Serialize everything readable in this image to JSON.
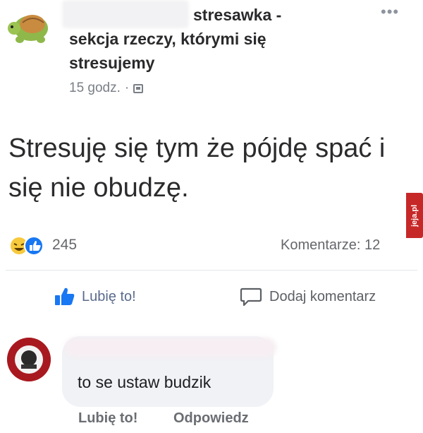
{
  "post": {
    "group_name": "stresawka - sekcja rzeczy, którymi się stresujemy",
    "time": "15 godz.",
    "separator": "·",
    "more": "•••",
    "text": "Stresuję się tym że pójdę spać i się nie obudzę.",
    "reaction_count": "245",
    "comments_label": "Komentarze: 12"
  },
  "actions": {
    "like_label": "Lubię to!",
    "comment_label": "Dodaj komentarz"
  },
  "comment": {
    "text": "to se ustaw budzik",
    "like_label": "Lubię to!",
    "reply_label": "Odpowiedz"
  },
  "watermark": {
    "text": "jeja.pl"
  },
  "colors": {
    "like_blue": "#1877f2",
    "text_gray": "#65676b",
    "bubble_bg": "#f0f2f5"
  },
  "icons": {
    "avatar": "turtle-avatar-icon",
    "privacy": "globe-icon",
    "like": "thumbs-up-icon",
    "comment": "speech-bubble-icon",
    "reactions": "haha-and-like-reaction-icons"
  }
}
